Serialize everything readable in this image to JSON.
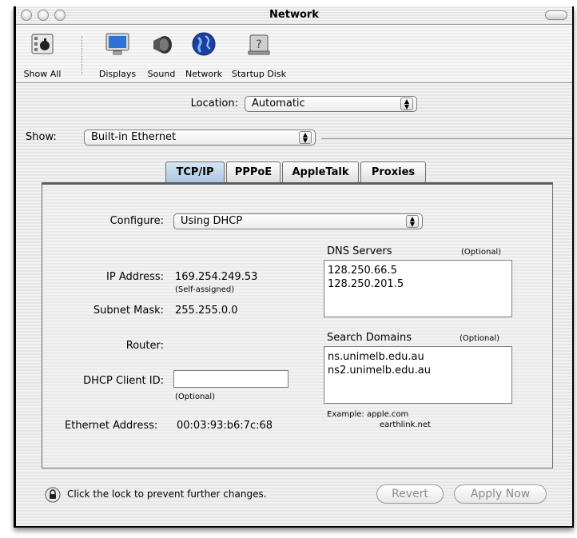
{
  "window": {
    "title": "Network"
  },
  "toolbar": {
    "items": [
      {
        "label": "Show All",
        "icon": "apple-icon"
      },
      {
        "label": "Displays",
        "icon": "display-icon"
      },
      {
        "label": "Sound",
        "icon": "speaker-icon"
      },
      {
        "label": "Network",
        "icon": "globe-icon"
      },
      {
        "label": "Startup Disk",
        "icon": "disk-icon"
      }
    ]
  },
  "location": {
    "label": "Location:",
    "value": "Automatic"
  },
  "show": {
    "label": "Show:",
    "value": "Built-in Ethernet"
  },
  "tabs": [
    "TCP/IP",
    "PPPoE",
    "AppleTalk",
    "Proxies"
  ],
  "tcpip": {
    "configure_label": "Configure:",
    "configure_value": "Using DHCP",
    "ip_label": "IP Address:",
    "ip_value": "169.254.249.53",
    "ip_note": "(Self-assigned)",
    "subnet_label": "Subnet Mask:",
    "subnet_value": "255.255.0.0",
    "router_label": "Router:",
    "dhcp_label": "DHCP Client ID:",
    "dhcp_value": "",
    "dhcp_note": "(Optional)",
    "ethernet_label": "Ethernet Address:",
    "ethernet_value": "00:03:93:b6:7c:68",
    "dns_label": "DNS Servers",
    "dns_optional": "(Optional)",
    "dns_servers": [
      "128.250.66.5",
      "128.250.201.5"
    ],
    "search_label": "Search Domains",
    "search_optional": "(Optional)",
    "search_domains": [
      "ns.unimelb.edu.au",
      "ns2.unimelb.edu.au"
    ],
    "example_label": "Example:",
    "example_values": [
      "apple.com",
      "earthlink.net"
    ]
  },
  "footer": {
    "lock_text": "Click the lock to prevent further changes.",
    "revert_label": "Revert",
    "apply_label": "Apply Now"
  },
  "colors": {
    "tab_selected": "#a9c3df",
    "disabled_text": "#8a8a8a"
  }
}
